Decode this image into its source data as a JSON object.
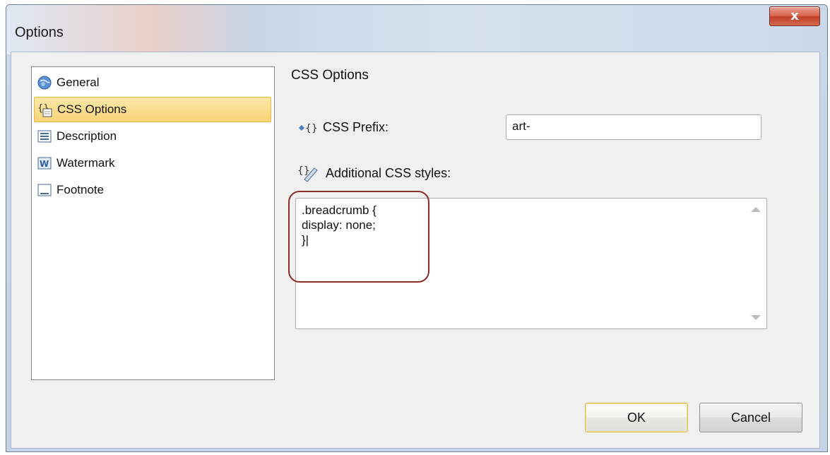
{
  "window": {
    "title": "Options",
    "close_label": "x"
  },
  "nav": {
    "items": [
      {
        "label": "General",
        "icon": "globe-icon"
      },
      {
        "label": "CSS Options",
        "icon": "css-braces-icon",
        "selected": true
      },
      {
        "label": "Description",
        "icon": "description-icon"
      },
      {
        "label": "Watermark",
        "icon": "watermark-icon"
      },
      {
        "label": "Footnote",
        "icon": "footnote-icon"
      }
    ]
  },
  "content": {
    "section_title": "CSS Options",
    "prefix_label": "CSS Prefix:",
    "prefix_value": "art-",
    "styles_label": "Additional CSS styles:",
    "styles_value": ".breadcrumb {\ndisplay: none;\n}|"
  },
  "buttons": {
    "ok": "OK",
    "cancel": "Cancel"
  },
  "colors": {
    "highlight": "#8a2c2c",
    "selected_bg": "#f8d478",
    "close_bg": "#c2402a"
  }
}
